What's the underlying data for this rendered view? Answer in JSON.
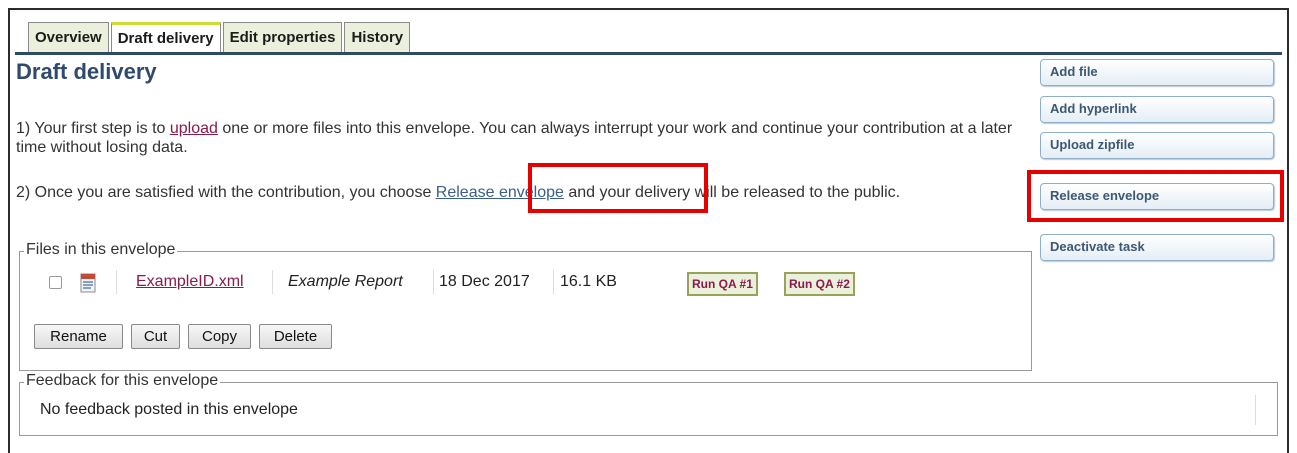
{
  "tabs": [
    {
      "label": "Overview",
      "active": false
    },
    {
      "label": "Draft delivery",
      "active": true
    },
    {
      "label": "Edit properties",
      "active": false
    },
    {
      "label": "History",
      "active": false
    }
  ],
  "page_title": "Draft delivery",
  "step1": {
    "prefix": "1) Your first step is to ",
    "link": "upload",
    "suffix": " one or more files into this envelope. You can always interrupt your work and continue your contribution at a later time without losing data."
  },
  "step2": {
    "prefix": "2) Once you are satisfied with the contribution, you choose ",
    "link": "Release envelope",
    "suffix": " and your delivery will be released to the public."
  },
  "side_buttons": {
    "add_file": "Add file",
    "add_hyperlink": "Add hyperlink",
    "upload_zipfile": "Upload zipfile",
    "release_envelope": "Release envelope",
    "deactivate_task": "Deactivate task"
  },
  "files_section": {
    "legend": "Files in this envelope",
    "files": [
      {
        "name": "ExampleID.xml",
        "title": "Example Report",
        "date": "18 Dec 2017",
        "size": "16.1 KB",
        "qa_buttons": [
          "Run QA #1",
          "Run QA #2"
        ],
        "icon": "xml-file-icon"
      }
    ],
    "actions": {
      "rename": "Rename",
      "cut": "Cut",
      "copy": "Copy",
      "delete": "Delete"
    }
  },
  "feedback_section": {
    "legend": "Feedback for this envelope",
    "message": "No feedback posted in this envelope"
  },
  "colors": {
    "title": "#2f4a6e",
    "tab_active_accent": "#cddc39",
    "link_visited": "#8b1a4a",
    "link": "#3b5e8c",
    "highlight_box": "#e60000"
  }
}
